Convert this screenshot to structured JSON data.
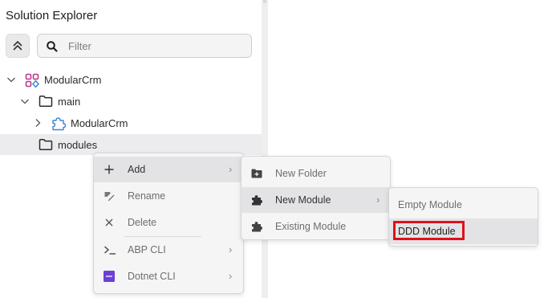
{
  "panel": {
    "title": "Solution Explorer",
    "filter_placeholder": "Filter",
    "collapse_icon": "chevrons-up-icon",
    "search_icon": "search-icon"
  },
  "tree": [
    {
      "label": "ModularCrm",
      "icon": "solution-icon",
      "expanded": true
    },
    {
      "label": "main",
      "icon": "folder-icon",
      "expanded": true
    },
    {
      "label": "ModularCrm",
      "icon": "module-puzzle-icon",
      "expanded": false
    },
    {
      "label": "modules",
      "icon": "folder-icon",
      "selected": true
    }
  ],
  "context_menu": {
    "items": [
      {
        "label": "Add",
        "icon": "plus-icon",
        "submenu": true,
        "highlighted": true
      },
      {
        "label": "Rename",
        "icon": "rename-icon"
      },
      {
        "label": "Delete",
        "icon": "close-icon"
      },
      {
        "label": "ABP CLI",
        "icon": "terminal-icon",
        "submenu": true
      },
      {
        "label": "Dotnet CLI",
        "icon": "dotnet-icon",
        "submenu": true
      }
    ]
  },
  "add_submenu": {
    "items": [
      {
        "label": "New Folder",
        "icon": "add-folder-icon"
      },
      {
        "label": "New Module",
        "icon": "puzzle-icon",
        "submenu": true,
        "highlighted": true
      },
      {
        "label": "Existing Module",
        "icon": "puzzle-icon"
      }
    ]
  },
  "module_submenu": {
    "items": [
      {
        "label": "Empty Module"
      },
      {
        "label": "DDD Module",
        "highlighted": true,
        "outlined": true
      }
    ]
  },
  "colors": {
    "highlight_outline": "#e0101a",
    "solution_icon_magenta": "#c0378a",
    "solution_icon_blue": "#3a86d9",
    "puzzle_icon_blue": "#3a86d9",
    "dotnet_icon": "#6d3fd6"
  }
}
